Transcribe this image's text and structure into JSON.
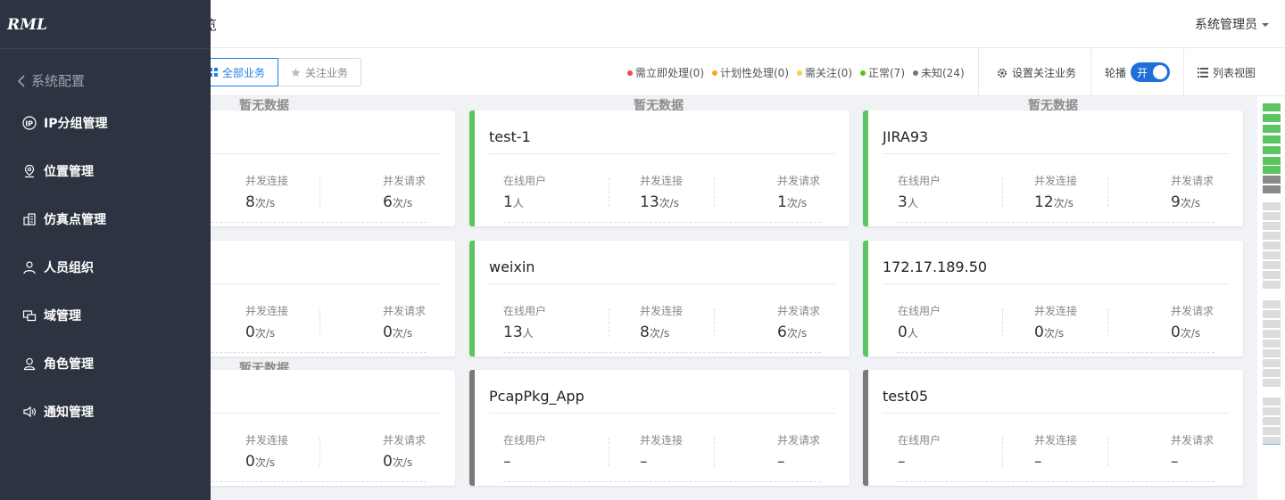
{
  "header": {
    "title_fragment": "览",
    "user_name": "系统管理员"
  },
  "toolbar": {
    "tabs": [
      {
        "label": "全部业务",
        "icon": "grid-icon",
        "active": true
      },
      {
        "label": "关注业务",
        "icon": "star-icon",
        "active": false
      }
    ],
    "legend": [
      {
        "label": "需立即处理(0)",
        "color": "#f5474d"
      },
      {
        "label": "计划性处理(0)",
        "color": "#f5a623"
      },
      {
        "label": "需关注(0)",
        "color": "#f0d33f"
      },
      {
        "label": "正常(7)",
        "color": "#52c41a"
      },
      {
        "label": "未知(24)",
        "color": "#777777"
      }
    ],
    "settings_label": "设置关注业务",
    "carousel_label": "轮播",
    "carousel_toggle_text": "开",
    "view_label": "列表视图"
  },
  "no_data_label": "暂无数据",
  "stat_labels": {
    "online_users": "在线用户",
    "concurrent_connections": "并发连接",
    "concurrent_requests": "并发请求"
  },
  "units": {
    "person": "人",
    "per_second": "次/s"
  },
  "cards": [
    {
      "name": "",
      "status": "unknown",
      "connections": "8",
      "requests": "6"
    },
    {
      "name": "test-1",
      "status": "normal",
      "users": "1",
      "connections": "13",
      "requests": "1"
    },
    {
      "name": "JIRA93",
      "status": "normal",
      "users": "3",
      "connections": "12",
      "requests": "9"
    },
    {
      "name": "",
      "status": "unknown",
      "connections": "0",
      "requests": "0"
    },
    {
      "name": "weixin",
      "status": "normal",
      "users": "13",
      "connections": "8",
      "requests": "6"
    },
    {
      "name": "172.17.189.50",
      "status": "normal",
      "users": "0",
      "connections": "0",
      "requests": "0"
    },
    {
      "name": "",
      "status": "unknown",
      "connections": "0",
      "requests": "0"
    },
    {
      "name": "PcapPkg_App",
      "status": "unknown",
      "users": "–",
      "connections": "–",
      "requests": "–"
    },
    {
      "name": "test05",
      "status": "unknown",
      "users": "–",
      "connections": "–",
      "requests": "–"
    }
  ],
  "status_colors": {
    "normal": "#5cc561",
    "unknown": "#7a7a7a"
  },
  "drawer": {
    "logo_text": "RML",
    "back_label": "系统配置",
    "items": [
      {
        "label": "IP分组管理",
        "icon": "ip-icon"
      },
      {
        "label": "位置管理",
        "icon": "location-icon"
      },
      {
        "label": "仿真点管理",
        "icon": "simulation-icon"
      },
      {
        "label": "人员组织",
        "icon": "user-icon"
      },
      {
        "label": "域管理",
        "icon": "domain-icon"
      },
      {
        "label": "角色管理",
        "icon": "role-icon"
      },
      {
        "label": "通知管理",
        "icon": "speaker-icon"
      }
    ]
  }
}
